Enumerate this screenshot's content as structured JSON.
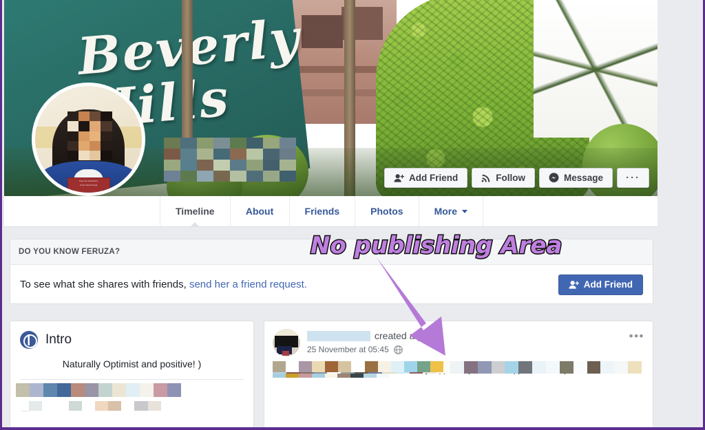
{
  "annotation": {
    "text": "No publishing Area",
    "color": "#bf7fe0",
    "outline_color": "#0d0d0d",
    "arrow_color": "#b57ad8",
    "frame_border_color": "#5b2d8e"
  },
  "cover": {
    "sign_line1": "Beverly",
    "sign_line2": "Hills",
    "actions": [
      {
        "label": "Add Friend",
        "icon": "add-friend-icon"
      },
      {
        "label": "Follow",
        "icon": "rss-follow-icon"
      },
      {
        "label": "Message",
        "icon": "messenger-icon"
      },
      {
        "label": "···",
        "icon": "more-options-icon"
      }
    ]
  },
  "tabs": [
    {
      "label": "Timeline",
      "active": true,
      "caret": false
    },
    {
      "label": "About",
      "active": false,
      "caret": false
    },
    {
      "label": "Friends",
      "active": false,
      "caret": false
    },
    {
      "label": "Photos",
      "active": false,
      "caret": false
    },
    {
      "label": "More",
      "active": false,
      "caret": true
    }
  ],
  "know_card": {
    "header": "DO YOU KNOW FERUZA?",
    "text_before_link": "To see what she shares with friends, ",
    "link_text": "send her a friend request.",
    "button_label": "Add Friend",
    "button_color": "#4267b2"
  },
  "intro": {
    "title": "Intro",
    "icon": "globe-icon",
    "bio": "Naturally Optimist and positive! )",
    "rows": [
      {
        "icon": "briefcase-icon",
        "text": "He",
        "redacted": true
      },
      {
        "icon": "briefcase-icon",
        "text": "Jo",
        "redacted": true
      }
    ]
  },
  "post": {
    "action_text": "created a poll.",
    "timestamp": "25 November at 05:45",
    "privacy_icon": "audience-globe-icon",
    "menu_icon": "post-menu-icon",
    "menu_label": "•••",
    "caption": "Агарда сиз хам шунака талантли, йуклдан бор кила оладиган ёшларни"
  }
}
